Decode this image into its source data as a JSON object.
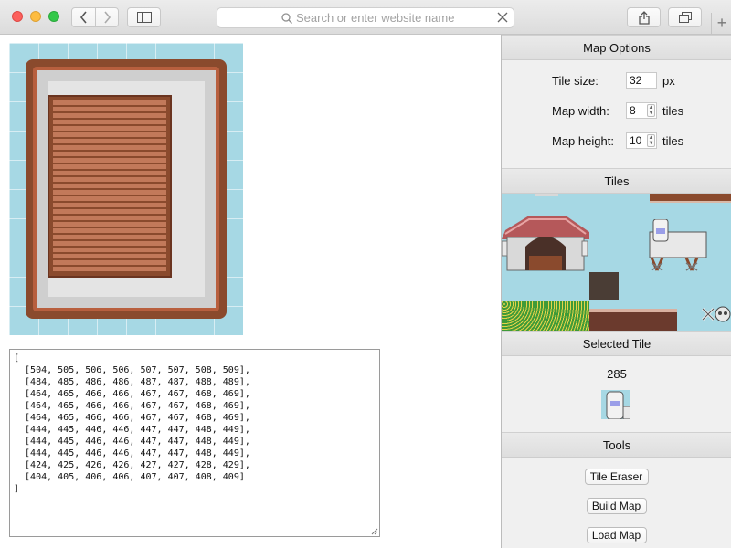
{
  "browser": {
    "address_placeholder": "Search or enter website name",
    "new_tab_label": "+"
  },
  "map_json": {
    "lines": [
      "[",
      "  [504, 505, 506, 506, 507, 507, 508, 509],",
      "  [484, 485, 486, 486, 487, 487, 488, 489],",
      "  [464, 465, 466, 466, 467, 467, 468, 469],",
      "  [464, 465, 466, 466, 467, 467, 468, 469],",
      "  [464, 465, 466, 466, 467, 467, 468, 469],",
      "  [444, 445, 446, 446, 447, 447, 448, 449],",
      "  [444, 445, 446, 446, 447, 447, 448, 449],",
      "  [444, 445, 446, 446, 447, 447, 448, 449],",
      "  [424, 425, 426, 426, 427, 427, 428, 429],",
      "  [404, 405, 406, 406, 407, 407, 408, 409]",
      "]"
    ]
  },
  "panel": {
    "map_options_title": "Map Options",
    "tile_size_label": "Tile size:",
    "tile_size_value": "32",
    "tile_size_unit": "px",
    "map_width_label": "Map width:",
    "map_width_value": "8",
    "map_width_unit": "tiles",
    "map_height_label": "Map height:",
    "map_height_value": "10",
    "map_height_unit": "tiles",
    "tiles_title": "Tiles",
    "selected_title": "Selected Tile",
    "selected_value": "285",
    "tools_title": "Tools",
    "tile_eraser_label": "Tile Eraser",
    "build_map_label": "Build Map",
    "load_map_label": "Load Map"
  },
  "colors": {
    "water": "#a6d8e4",
    "wood_dark": "#8a4a2d",
    "wood_light": "#c2795a"
  }
}
